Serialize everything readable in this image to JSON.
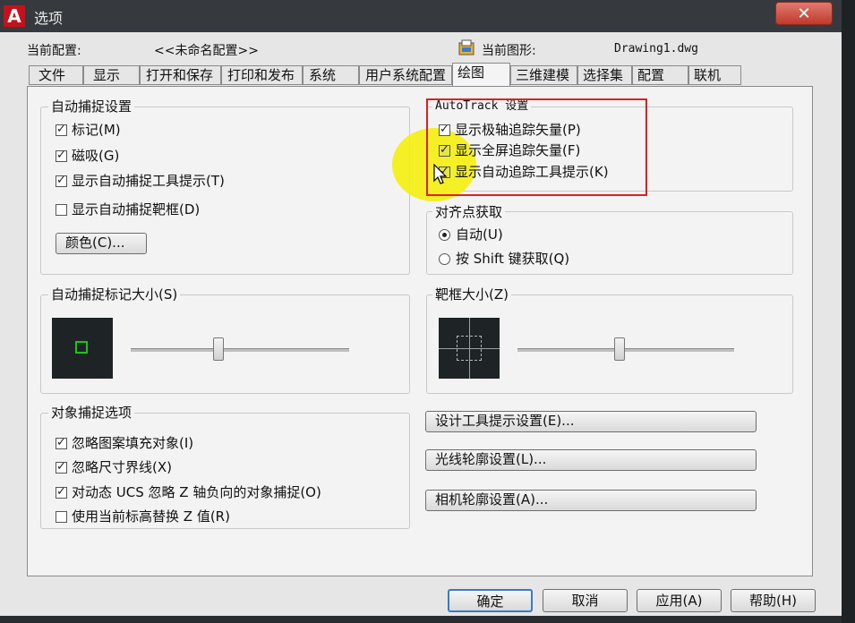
{
  "window": {
    "title": "选项",
    "close_label": "✕"
  },
  "header": {
    "profile_label": "当前配置:",
    "profile_value": "<<未命名配置>>",
    "drawing_label": "当前图形:",
    "drawing_value": "Drawing1.dwg"
  },
  "tabs": [
    "文件",
    "显示",
    "打开和保存",
    "打印和发布",
    "系统",
    "用户系统配置",
    "绘图",
    "三维建模",
    "选择集",
    "配置",
    "联机"
  ],
  "active_tab": "绘图",
  "autosnap": {
    "title": "自动捕捉设置",
    "items": [
      {
        "label": "标记(M)",
        "checked": true
      },
      {
        "label": "磁吸(G)",
        "checked": true
      },
      {
        "label": "显示自动捕捉工具提示(T)",
        "checked": true
      },
      {
        "label": "显示自动捕捉靶框(D)",
        "checked": false
      }
    ],
    "color_button": "颜色(C)..."
  },
  "autotrack": {
    "title": "AutoTrack 设置",
    "items": [
      {
        "label": "显示极轴追踪矢量(P)",
        "checked": true
      },
      {
        "label": "显示全屏追踪矢量(F)",
        "checked": true
      },
      {
        "label": "显示自动追踪工具提示(K)",
        "checked": true
      }
    ]
  },
  "alignment": {
    "title": "对齐点获取",
    "options": [
      {
        "label": "自动(U)",
        "selected": true
      },
      {
        "label": "按 Shift 键获取(Q)",
        "selected": false
      }
    ]
  },
  "marker_size": {
    "title": "自动捕捉标记大小(S)",
    "slider_fraction": 0.4
  },
  "aperture_size": {
    "title": "靶框大小(Z)",
    "slider_fraction": 0.47
  },
  "osnap": {
    "title": "对象捕捉选项",
    "items": [
      {
        "label": "忽略图案填充对象(I)",
        "checked": true
      },
      {
        "label": "忽略尺寸界线(X)",
        "checked": true
      },
      {
        "label": "对动态 UCS 忽略 Z 轴负向的对象捕捉(O)",
        "checked": true
      },
      {
        "label": "使用当前标高替换 Z 值(R)",
        "checked": false
      }
    ]
  },
  "settings_buttons": [
    "设计工具提示设置(E)...",
    "光线轮廓设置(L)...",
    "相机轮廓设置(A)..."
  ],
  "footer": {
    "ok": "确定",
    "cancel": "取消",
    "apply": "应用(A)",
    "help": "帮助(H)"
  },
  "colors": {
    "highlight": "#f5f014",
    "annotation_box": "#e02020",
    "marker": "#1cc41c"
  }
}
